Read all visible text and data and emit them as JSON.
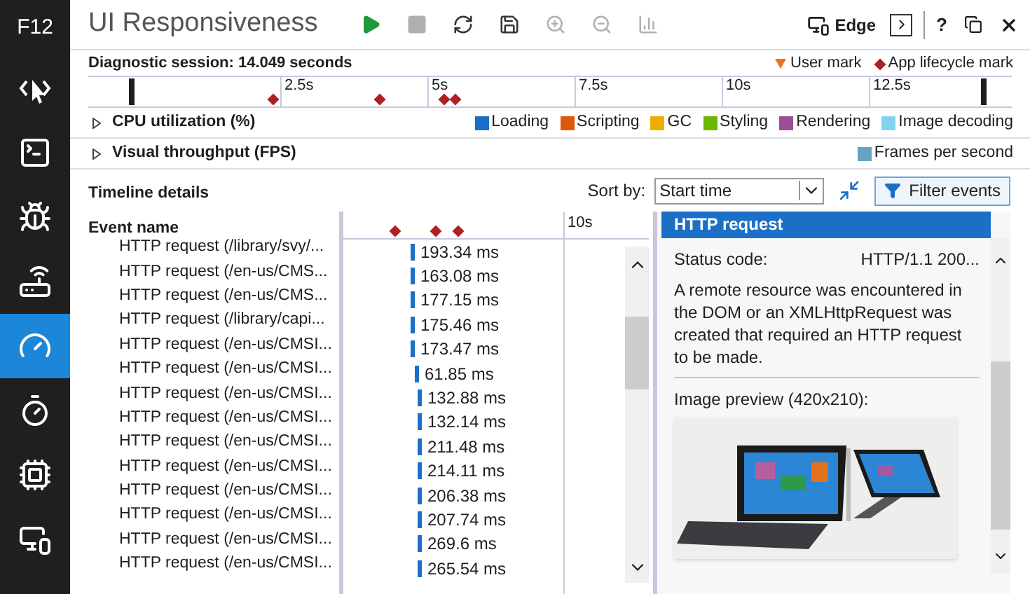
{
  "sidebar": {
    "label": "F12",
    "items": [
      {
        "selected": false
      },
      {
        "selected": false
      },
      {
        "selected": false
      },
      {
        "selected": false
      },
      {
        "selected": true
      },
      {
        "selected": false
      },
      {
        "selected": false
      },
      {
        "selected": false
      }
    ]
  },
  "title": "UI Responsiveness",
  "toolbar": [
    {
      "disabled": false
    },
    {
      "disabled": true
    },
    {
      "disabled": false
    },
    {
      "disabled": false
    },
    {
      "disabled": true
    },
    {
      "disabled": true
    },
    {
      "disabled": true
    }
  ],
  "target": {
    "label": "Edge"
  },
  "window_buttons": [
    "?"
  ],
  "session": {
    "label": "Diagnostic session: 14.049 seconds",
    "legend": [
      {
        "label": "User mark",
        "color": "#f07020",
        "kind": "triangle"
      },
      {
        "label": "App lifecycle mark",
        "color": "#b02020",
        "kind": "diamond"
      }
    ]
  },
  "ruler": {
    "ticks": [
      "2.5s",
      "5s",
      "7.5s",
      "10s",
      "12.5s"
    ]
  },
  "sections": [
    {
      "title": "CPU utilization (%)",
      "expanded": false,
      "legend": [
        {
          "label": "Loading",
          "color": "#1c6fc7"
        },
        {
          "label": "Scripting",
          "color": "#e0570c"
        },
        {
          "label": "GC",
          "color": "#f0ad00"
        },
        {
          "label": "Styling",
          "color": "#6bb700"
        },
        {
          "label": "Rendering",
          "color": "#9b4f96"
        },
        {
          "label": "Image decoding",
          "color": "#80d4f2"
        }
      ]
    },
    {
      "title": "Visual throughput (FPS)",
      "expanded": false,
      "legend": [
        {
          "label": "Frames per second",
          "color": "#6aa2c4"
        }
      ]
    }
  ],
  "details": {
    "title": "Timeline details",
    "sort_label": "Sort by:",
    "sort_value": "Start time",
    "filter_button": "Filter events",
    "column": "Event name",
    "time_tick": "10s",
    "rows": [
      {
        "name": "HTTP request (/library/svy/...",
        "duration": "193.34 ms"
      },
      {
        "name": "HTTP request (/en-us/CMS...",
        "duration": "163.08 ms"
      },
      {
        "name": "HTTP request (/en-us/CMS...",
        "duration": "177.15 ms"
      },
      {
        "name": "HTTP request (/library/capi...",
        "duration": "175.46 ms"
      },
      {
        "name": "HTTP request (/en-us/CMSI...",
        "duration": "173.47 ms"
      },
      {
        "name": "HTTP request (/en-us/CMSI...",
        "duration": "61.85 ms"
      },
      {
        "name": "HTTP request (/en-us/CMSI...",
        "duration": "132.88 ms"
      },
      {
        "name": "HTTP request (/en-us/CMSI...",
        "duration": "132.14 ms"
      },
      {
        "name": "HTTP request (/en-us/CMSI...",
        "duration": "211.48 ms"
      },
      {
        "name": "HTTP request (/en-us/CMSI...",
        "duration": "214.11 ms"
      },
      {
        "name": "HTTP request (/en-us/CMSI...",
        "duration": "206.38 ms"
      },
      {
        "name": "HTTP request (/en-us/CMSI...",
        "duration": "207.74 ms"
      },
      {
        "name": "HTTP request (/en-us/CMSI...",
        "duration": "269.6 ms"
      },
      {
        "name": "HTTP request (/en-us/CMSI...",
        "duration": "265.54 ms"
      }
    ]
  },
  "panel": {
    "title": "HTTP request",
    "fields": [
      {
        "label": "Status code:",
        "value": "HTTP/1.1 200..."
      }
    ],
    "description": "A remote resource was encountered in the DOM or an XMLHttpRequest was created that required an HTTP request to be made.",
    "preview_label": "Image preview (420x210):"
  }
}
